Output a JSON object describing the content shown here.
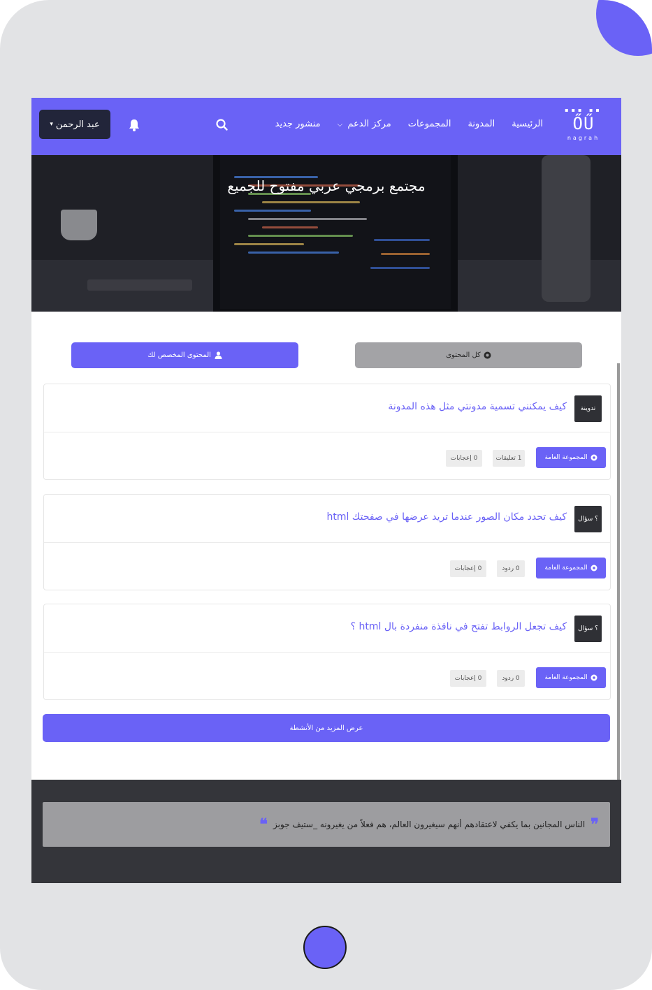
{
  "brand": {
    "mark": "ŐŰ",
    "wordmark": "nagrah"
  },
  "colors": {
    "accent": "#6a62f6",
    "dark": "#22253a"
  },
  "nav": {
    "links": [
      {
        "label": "الرئيسية"
      },
      {
        "label": "المدونة"
      },
      {
        "label": "المجموعات"
      },
      {
        "label": "مركز الدعم",
        "has_dropdown": true
      },
      {
        "label": "منشور جديد"
      }
    ],
    "user_label": "عبد الرحمن",
    "icons": {
      "search": "search-icon",
      "bell": "bell-icon"
    }
  },
  "hero": {
    "title": "مجتمع برمجي عربي مفتوح للجميع"
  },
  "tabs": {
    "all_label": "كل المحتوى",
    "mine_label": "المحتوى المخصص لك"
  },
  "posts": [
    {
      "type": "تدوينة",
      "title": "كيف يمكنني تسمية مدونتي مثل هذه المدونة",
      "group": "المجموعة العامة",
      "stat_a": "1 تعليقات",
      "stat_b": "0 إعجابات"
    },
    {
      "type": "؟ سؤال",
      "title": "كيف تحدد مكان الصور عندما تريد عرضها في صفحتك html",
      "group": "المجموعة العامة",
      "stat_a": "0 ردود",
      "stat_b": "0 إعجابات"
    },
    {
      "type": "؟ سؤال",
      "title": "كيف تجعل الروابط تفتح في نافذة منفردة بال html ؟",
      "group": "المجموعة العامة",
      "stat_a": "0 ردود",
      "stat_b": "0 إعجابات"
    }
  ],
  "load_more_label": "عرض المزيد من الأنشطة",
  "quote": {
    "text": "الناس المجانين بما يكفي لاعتقادهم أنهم سيغيرون العالم، هم فعلاً من يغيرونه _ستيف جوبز",
    "open_mark": "❞",
    "close_mark": "❝"
  }
}
